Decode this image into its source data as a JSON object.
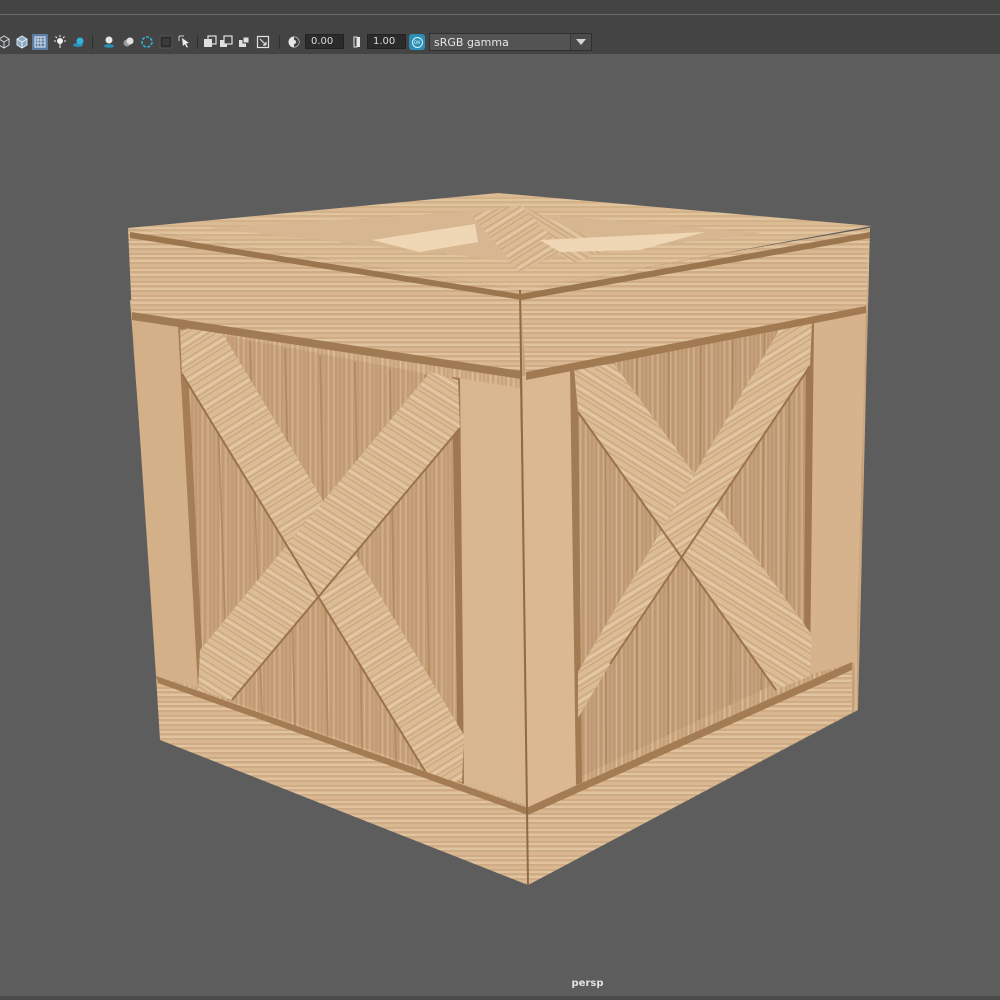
{
  "toolbar": {
    "tools": [
      {
        "name": "wireframe-on-shaded-icon",
        "active": false
      },
      {
        "name": "textured-cube-icon",
        "active": false
      },
      {
        "name": "xray-icon",
        "active": true
      },
      {
        "name": "use-all-lights-icon",
        "active": false
      },
      {
        "name": "shadows-icon",
        "active": false
      },
      {
        "name": "screen-space-ao-icon",
        "active": false
      },
      {
        "name": "motion-blur-icon",
        "active": false
      },
      {
        "name": "multisample-aa-icon",
        "active": false
      },
      {
        "name": "depth-of-field-icon",
        "active": false
      },
      {
        "name": "isolate-select-icon",
        "active": false
      },
      {
        "name": "xray-joints-icon",
        "active": false
      },
      {
        "name": "xray-active-components-icon",
        "active": false
      },
      {
        "name": "backface-culling-icon",
        "active": false
      },
      {
        "name": "smooth-wireframe-icon",
        "active": false
      },
      {
        "name": "exposure-icon",
        "active": false
      },
      {
        "name": "gamma-icon",
        "active": false
      }
    ],
    "exposure_value": "0.00",
    "gamma_value": "1.00",
    "color_management_badge": "ON",
    "view_transform": "sRGB gamma"
  },
  "viewport": {
    "camera_name": "persp"
  },
  "colors": {
    "panel": "#444444",
    "viewport_bg": "#5d5d5d",
    "accent": "#2a8fb5",
    "wood_light": "#d8b690",
    "wood_dark": "#b08a62"
  }
}
